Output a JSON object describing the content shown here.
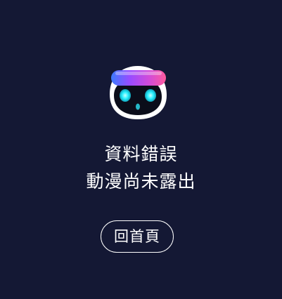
{
  "error": {
    "line1": "資料錯誤",
    "line2": "動漫尚未露出"
  },
  "actions": {
    "home_label": "回首頁"
  },
  "mascot": {
    "icon": "robot-mascot-icon"
  },
  "colors": {
    "background": "#141834",
    "text": "#ffffff",
    "headband_start": "#7b3cff",
    "headband_end": "#ff4fb0",
    "eye_glow": "#18e6ff"
  }
}
